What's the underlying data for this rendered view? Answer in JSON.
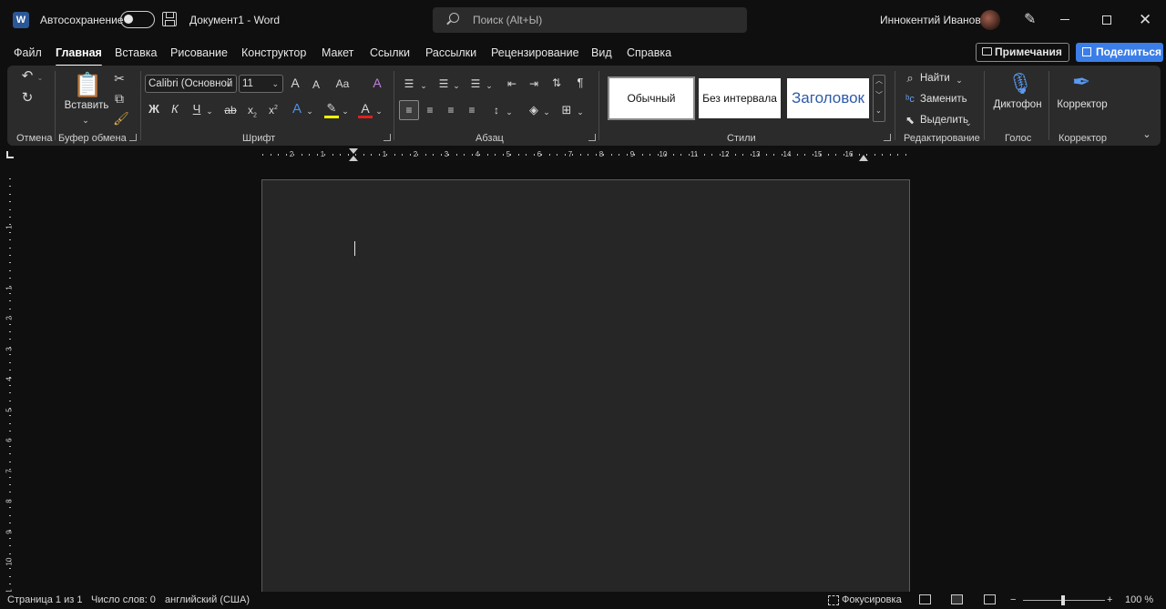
{
  "titlebar": {
    "app_logo": "W",
    "autosave_label": "Автосохранение",
    "document_title": "Документ1  -  Word",
    "search_placeholder": "Поиск (Alt+Ы)",
    "user_name": "Иннокентий Иванов"
  },
  "tabs": [
    "Файл",
    "Главная",
    "Вставка",
    "Рисование",
    "Конструктор",
    "Макет",
    "Ссылки",
    "Рассылки",
    "Рецензирование",
    "Вид",
    "Справка"
  ],
  "active_tab": "Главная",
  "actions": {
    "comments_label": "Примечания",
    "share_label": "Поделиться"
  },
  "ribbon": {
    "groups": {
      "undo": "Отмена",
      "clipboard": "Буфер обмена",
      "font": "Шрифт",
      "paragraph": "Абзац",
      "styles": "Стили",
      "editing": "Редактирование",
      "voice": "Голос",
      "editor": "Корректор"
    },
    "paste_label": "Вставить",
    "font_name": "Calibri (Основной",
    "font_size": "11",
    "font_grow": "A",
    "font_shrink": "A",
    "change_case": "Aa",
    "bold": "Ж",
    "italic": "К",
    "underline": "Ч",
    "strikethrough": "ab",
    "subscript": "x",
    "superscript": "x",
    "styles": [
      "Обычный",
      "Без интервала",
      "Заголовок"
    ],
    "find_label": "Найти",
    "replace_label": "Заменить",
    "select_label": "Выделить",
    "dictate_label": "Диктофон",
    "editor_label": "Корректор"
  },
  "ruler": {
    "labels": [
      "2",
      "1",
      "1",
      "2",
      "3",
      "4",
      "5",
      "6",
      "7",
      "8",
      "9",
      "10",
      "11",
      "12",
      "13",
      "14",
      "15",
      "16"
    ],
    "vertical_labels": [
      "1",
      "1",
      "2",
      "3",
      "4",
      "5",
      "6",
      "7",
      "8",
      "9",
      "10",
      "11"
    ]
  },
  "statusbar": {
    "page": "Страница 1 из 1",
    "words": "Число слов: 0",
    "language": "английский (США)",
    "focus": "Фокусировка",
    "zoom": "100 %",
    "zoom_minus": "−",
    "zoom_plus": "+"
  },
  "colors": {
    "accent": "#3b7ee8",
    "highlight": "#ffff00",
    "font_color": "#e02020",
    "background": "#0f0f0f",
    "ribbon": "#2b2b2b",
    "page": "#262626"
  }
}
